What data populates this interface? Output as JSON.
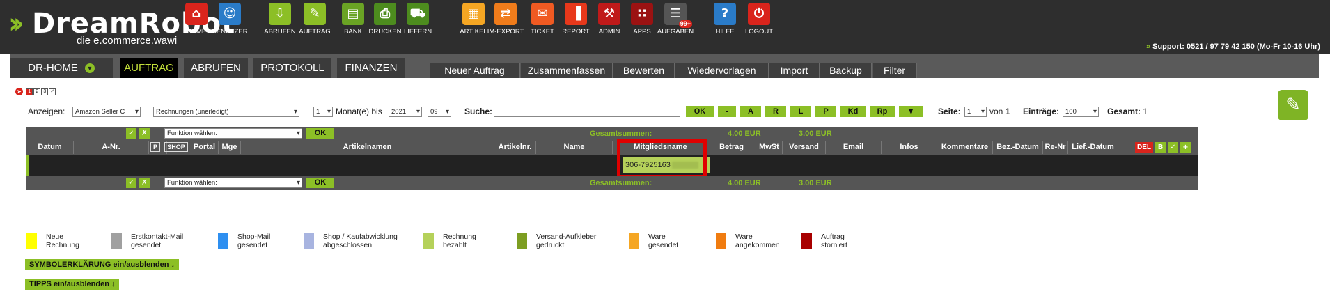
{
  "brand": {
    "name_a": "Dream",
    "name_b": "Robot",
    "tagline": "die e.commerce.wawi"
  },
  "nav": [
    {
      "label": "HOME",
      "icon": "home-icon",
      "glyph": "⌂",
      "color": "#d9241c"
    },
    {
      "label": "BENUTZER",
      "icon": "user-icon",
      "glyph": "☺",
      "color": "#2a7bc8"
    },
    {
      "label": "ABRUFEN",
      "icon": "download-icon",
      "glyph": "⇩",
      "color": "#8cbf26"
    },
    {
      "label": "AUFTRAG",
      "icon": "order-icon",
      "glyph": "✎",
      "color": "#8cbf26"
    },
    {
      "label": "BANK",
      "icon": "bank-icon",
      "glyph": "▤",
      "color": "#6aa324"
    },
    {
      "label": "DRUCKEN",
      "icon": "print-icon",
      "glyph": "⎙",
      "color": "#4d8c1e"
    },
    {
      "label": "LIEFERN",
      "icon": "cart-icon",
      "glyph": "⛟",
      "color": "#4d8c1e"
    },
    {
      "label": "ARTIKEL",
      "icon": "boxes-icon",
      "glyph": "▦",
      "color": "#f5a623"
    },
    {
      "label": "IM-EXPORT",
      "icon": "exchange-icon",
      "glyph": "⇄",
      "color": "#f07c1b"
    },
    {
      "label": "TICKET",
      "icon": "mail-icon",
      "glyph": "✉",
      "color": "#f05a22"
    },
    {
      "label": "REPORT",
      "icon": "chart-icon",
      "glyph": "▐",
      "color": "#e8381b"
    },
    {
      "label": "ADMIN",
      "icon": "tools-icon",
      "glyph": "⚒",
      "color": "#c01a1a"
    },
    {
      "label": "APPS",
      "icon": "apps-icon",
      "glyph": "∷",
      "color": "#9b1212"
    },
    {
      "label": "AUFGABEN",
      "icon": "tasks-icon",
      "glyph": "☰",
      "color": "#555555",
      "badge": "99+"
    },
    {
      "label": "HILFE",
      "icon": "help-icon",
      "glyph": "?",
      "color": "#2a7bc8"
    },
    {
      "label": "LOGOUT",
      "icon": "power-icon",
      "glyph": "⏻",
      "color": "#d9241c"
    }
  ],
  "support": "Support: 0521 / 97 79 42 150 (Mo-Fr 10-16 Uhr)",
  "main_tabs": [
    "DR-HOME",
    "AUFTRAG",
    "ABRUFEN",
    "PROTOKOLL",
    "FINANZEN"
  ],
  "sub_tabs": [
    "Neuer Auftrag",
    "Zusammenfassen",
    "Bewerten",
    "Wiedervorlagen",
    "Import",
    "Backup",
    "Filter"
  ],
  "steps": [
    "1",
    "2",
    "3",
    "✓"
  ],
  "filters": {
    "anzeigen_label": "Anzeigen:",
    "channel": "Amazon Seller C",
    "status": "Rechnungen (unerledigt)",
    "months": "1",
    "months_label": "Monat(e) bis",
    "year": "2021",
    "month": "09",
    "search_label": "Suche:",
    "search_value": "",
    "buttons": [
      "OK",
      "-",
      "A",
      "R",
      "L",
      "P",
      "Kd",
      "Rp"
    ],
    "filter_icon": "funnel-icon",
    "page_label": "Seite:",
    "page": "1",
    "page_of": "von",
    "page_total": "1",
    "entries_label": "Einträge:",
    "entries": "100",
    "total_label": "Gesamt:",
    "total": "1"
  },
  "table": {
    "function_placeholder": "Funktion wählen:",
    "ok": "OK",
    "sum_label": "Gesamtsummen:",
    "sum_brutto": "4.00 EUR",
    "sum_versand": "3.00 EUR",
    "columns": [
      "Datum",
      "A-Nr.",
      "P",
      "SHOP",
      "Portal",
      "Mge",
      "Artikelnamen",
      "Artikelnr.",
      "Name",
      "Mitgliedsname",
      "Betrag",
      "MwSt",
      "Versand",
      "Email",
      "Infos",
      "Kommentare",
      "Bez.-Datum",
      "Re-Nr",
      "Lief.-Datum"
    ],
    "del": "DEL",
    "b": "B",
    "rows": [
      {
        "mitgliedsname": "306-7925163"
      }
    ]
  },
  "legend": [
    {
      "color": "#ffff00",
      "l1": "Neue",
      "l2": "Rechnung"
    },
    {
      "color": "#a0a0a0",
      "l1": "Erstkontakt-Mail",
      "l2": "gesendet"
    },
    {
      "color": "#2e8ff0",
      "l1": "Shop-Mail",
      "l2": "gesendet"
    },
    {
      "color": "#a8b4e0",
      "l1": "Shop / Kaufabwicklung",
      "l2": "abgeschlossen"
    },
    {
      "color": "#b5d15a",
      "l1": "Rechnung",
      "l2": "bezahlt"
    },
    {
      "color": "#7d9e22",
      "l1": "Versand-Aufkleber",
      "l2": "gedruckt"
    },
    {
      "color": "#f5a623",
      "l1": "Ware",
      "l2": "gesendet"
    },
    {
      "color": "#f07c10",
      "l1": "Ware",
      "l2": "angekommen"
    },
    {
      "color": "#a80000",
      "l1": "Auftrag",
      "l2": "storniert"
    }
  ],
  "toggles": [
    "SYMBOLERKLÄRUNG ein/ausblenden ↓",
    "TIPPS ein/ausblenden ↓"
  ]
}
